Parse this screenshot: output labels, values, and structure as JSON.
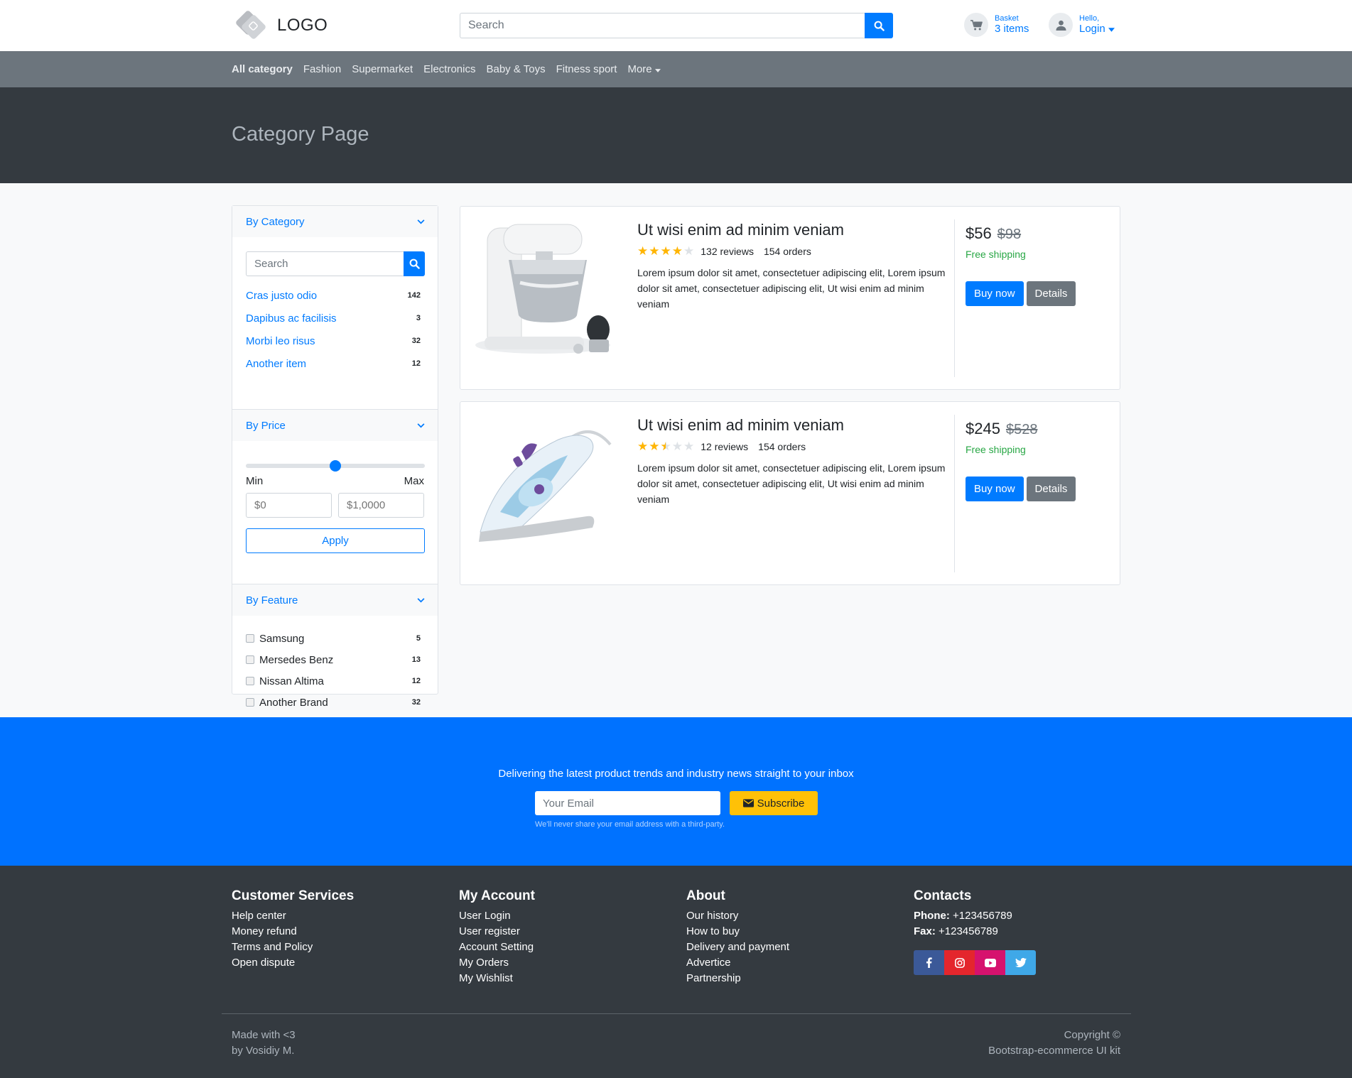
{
  "header": {
    "logo_text": "LOGO",
    "search_placeholder": "Search",
    "basket_label": "Basket",
    "basket_count": "3 items",
    "user_greeting": "Hello,",
    "user_login": "Login"
  },
  "nav": {
    "items": [
      "All category",
      "Fashion",
      "Supermarket",
      "Electronics",
      "Baby & Toys",
      "Fitness sport",
      "More"
    ]
  },
  "banner": {
    "title": "Category Page"
  },
  "sidebar": {
    "category": {
      "title": "By Category",
      "search_placeholder": "Search",
      "items": [
        {
          "label": "Cras justo odio",
          "count": "142"
        },
        {
          "label": "Dapibus ac facilisis",
          "count": "3"
        },
        {
          "label": "Morbi leo risus",
          "count": "32"
        },
        {
          "label": "Another item",
          "count": "12"
        }
      ]
    },
    "price": {
      "title": "By Price",
      "slider_value": 0.5,
      "min_label": "Min",
      "max_label": "Max",
      "min_placeholder": "$0",
      "max_placeholder": "$1,0000",
      "apply_label": "Apply"
    },
    "feature": {
      "title": "By Feature",
      "items": [
        {
          "label": "Samsung",
          "count": "5"
        },
        {
          "label": "Mersedes Benz",
          "count": "13"
        },
        {
          "label": "Nissan Altima",
          "count": "12"
        },
        {
          "label": "Another Brand",
          "count": "32"
        }
      ]
    }
  },
  "products": [
    {
      "title": "Ut wisi enim ad minim veniam",
      "rating": 4,
      "reviews": "132 reviews",
      "orders": "154 orders",
      "description": "Lorem ipsum dolor sit amet, consectetuer adipiscing elit, Lorem ipsum dolor sit amet, consectetuer adipiscing elit, Ut wisi enim ad minim veniam",
      "price": "$56",
      "old_price": "$98",
      "shipping": "Free shipping",
      "buy_label": "Buy now",
      "details_label": "Details",
      "image": "stand-mixer-image"
    },
    {
      "title": "Ut wisi enim ad minim veniam",
      "rating": 2.5,
      "reviews": "12 reviews",
      "orders": "154 orders",
      "description": "Lorem ipsum dolor sit amet, consectetuer adipiscing elit, Lorem ipsum dolor sit amet, consectetuer adipiscing elit, Ut wisi enim ad minim veniam",
      "price": "$245",
      "old_price": "$528",
      "shipping": "Free shipping",
      "buy_label": "Buy now",
      "details_label": "Details",
      "image": "steam-iron-image"
    }
  ],
  "newsletter": {
    "text": "Delivering the latest product trends and industry news straight to your inbox",
    "email_placeholder": "Your Email",
    "subscribe_label": "Subscribe",
    "note": "We'll never share your email address with a third-party."
  },
  "footer": {
    "customer_services": {
      "title": "Customer Services",
      "links": [
        "Help center",
        "Money refund",
        "Terms and Policy",
        "Open dispute"
      ]
    },
    "my_account": {
      "title": "My Account",
      "links": [
        "User Login",
        "User register",
        "Account Setting",
        "My Orders",
        "My Wishlist"
      ]
    },
    "about": {
      "title": "About",
      "links": [
        "Our history",
        "How to buy",
        "Delivery and payment",
        "Advertice",
        "Partnership"
      ]
    },
    "contacts": {
      "title": "Contacts",
      "phone_label": "Phone:",
      "phone": "+123456789",
      "fax_label": "Fax:",
      "fax": "+123456789",
      "social": [
        "facebook-icon",
        "instagram-icon",
        "youtube-icon",
        "twitter-icon"
      ]
    },
    "made_with_line1": "Made with <3",
    "made_with_line2": "by Vosidiy M.",
    "copyright_line1": "Copyright ©",
    "copyright_line2": "Bootstrap-ecommerce UI kit"
  },
  "colors": {
    "primary": "#007bff",
    "nav_bg": "#6c757d",
    "dark_bg": "#343a40",
    "newsletter_bg": "#0072ff",
    "subscribe": "#ffc107",
    "success": "#28a745",
    "star": "#ffb503",
    "facebook": "#3b5998",
    "instagram": "#e4262d",
    "youtube": "#d6126e",
    "twitter": "#3fa8e8"
  }
}
